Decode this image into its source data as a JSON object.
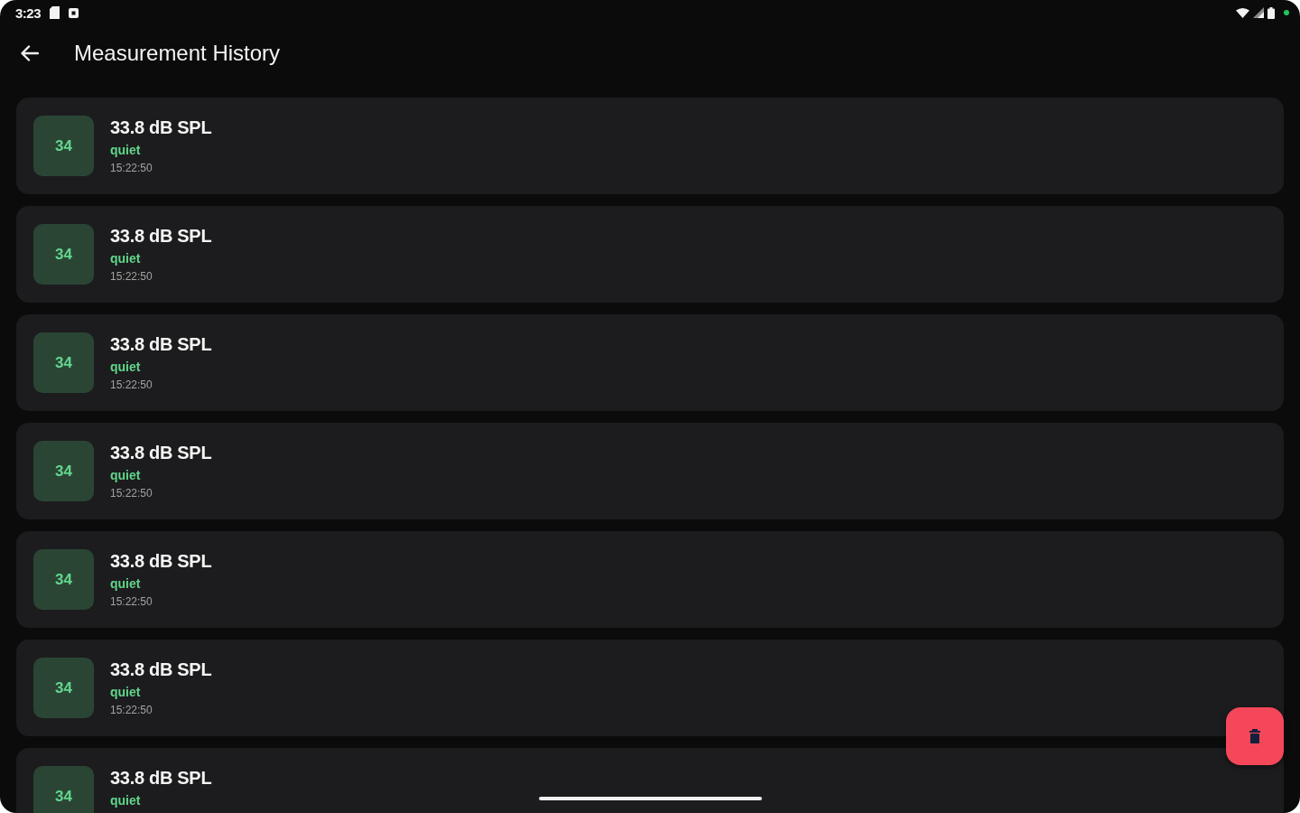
{
  "status_bar": {
    "time": "3:23"
  },
  "app_bar": {
    "title": "Measurement History"
  },
  "measurements": [
    {
      "badge": "34",
      "value": "33.8 dB SPL",
      "level": "quiet",
      "time": "15:22:50"
    },
    {
      "badge": "34",
      "value": "33.8 dB SPL",
      "level": "quiet",
      "time": "15:22:50"
    },
    {
      "badge": "34",
      "value": "33.8 dB SPL",
      "level": "quiet",
      "time": "15:22:50"
    },
    {
      "badge": "34",
      "value": "33.8 dB SPL",
      "level": "quiet",
      "time": "15:22:50"
    },
    {
      "badge": "34",
      "value": "33.8 dB SPL",
      "level": "quiet",
      "time": "15:22:50"
    },
    {
      "badge": "34",
      "value": "33.8 dB SPL",
      "level": "quiet",
      "time": "15:22:50"
    },
    {
      "badge": "34",
      "value": "33.8 dB SPL",
      "level": "quiet"
    }
  ]
}
